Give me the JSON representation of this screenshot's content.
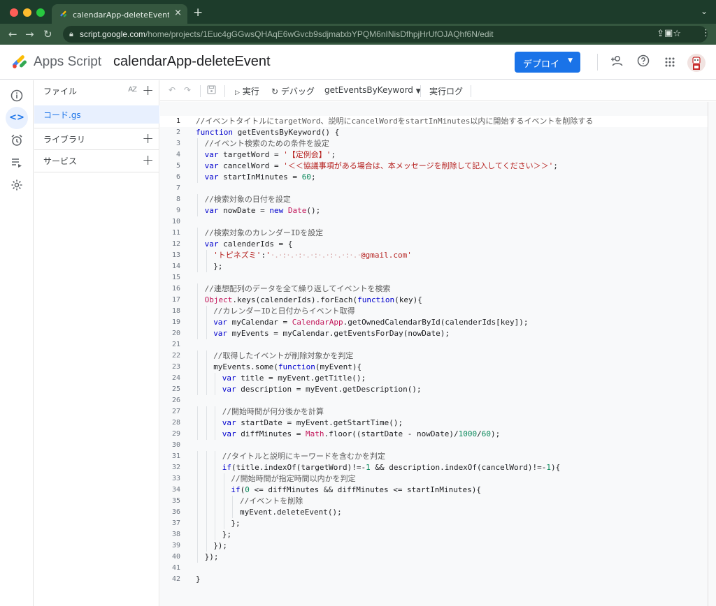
{
  "browser": {
    "tab_title": "calendarApp-deleteEvent - プロ",
    "url_host": "script.google.com",
    "url_path": "/home/projects/1Euc4gGGwsQHAqE6wGvcb9sdjmatxbYPQM6nINisDfhpjHrUfOJAQhf6N/edit"
  },
  "header": {
    "product": "Apps Script",
    "project_title": "calendarApp-deleteEvent",
    "deploy_label": "デプロイ",
    "icons": [
      "add-person-icon",
      "help-icon",
      "apps-grid-icon",
      "avatar"
    ]
  },
  "rail": {
    "items": [
      "info-icon",
      "code-icon",
      "alarm-icon",
      "executions-icon",
      "settings-icon"
    ],
    "active": "code-icon"
  },
  "files_panel": {
    "files_label": "ファイル",
    "sort_label": "AZ",
    "file": "コード.gs",
    "libraries_label": "ライブラリ",
    "services_label": "サービス"
  },
  "toolbar": {
    "run_label": "実行",
    "debug_label": "デバッグ",
    "function_name": "getEventsByKeyword",
    "log_label": "実行ログ"
  },
  "colors": {
    "accent": "#1a73e8",
    "chrome_green": "#35573f",
    "keyword": "#0000cd",
    "string": "#b5201e",
    "number": "#09885a",
    "object": "#c2185b"
  },
  "editor": {
    "current_line": 1,
    "lines": [
      {
        "n": "1",
        "indent": 0,
        "t": [
          [
            "com",
            "//イベントタイトルにtargetWord、説明にcancelWordをstartInMinutes以内に開始するイベントを削除する"
          ]
        ]
      },
      {
        "n": "2",
        "indent": 0,
        "t": [
          [
            "kw",
            "function"
          ],
          [
            "fn",
            " getEventsByKeyword() {"
          ]
        ]
      },
      {
        "n": "3",
        "indent": 1,
        "t": [
          [
            "com",
            "//イベント検索のための条件を設定"
          ]
        ]
      },
      {
        "n": "4",
        "indent": 1,
        "t": [
          [
            "kw",
            "var"
          ],
          [
            "fn",
            " targetWord = "
          ],
          [
            "str",
            "'【定例会】'"
          ],
          [
            "fn",
            ";"
          ]
        ]
      },
      {
        "n": "5",
        "indent": 1,
        "t": [
          [
            "kw",
            "var"
          ],
          [
            "fn",
            " cancelWord = "
          ],
          [
            "str",
            "'＜＜協議事項がある場合は、本メッセージを削除して記入してください＞＞'"
          ],
          [
            "fn",
            ";"
          ]
        ]
      },
      {
        "n": "6",
        "indent": 1,
        "t": [
          [
            "kw",
            "var"
          ],
          [
            "fn",
            " startInMinutes = "
          ],
          [
            "num",
            "60"
          ],
          [
            "fn",
            ";"
          ]
        ]
      },
      {
        "n": "7",
        "indent": 0,
        "t": []
      },
      {
        "n": "8",
        "indent": 1,
        "t": [
          [
            "com",
            "//検索対象の日付を設定"
          ]
        ]
      },
      {
        "n": "9",
        "indent": 1,
        "t": [
          [
            "kw",
            "var"
          ],
          [
            "fn",
            " nowDate = "
          ],
          [
            "kw",
            "new"
          ],
          [
            "fn",
            " "
          ],
          [
            "obj",
            "Date"
          ],
          [
            "fn",
            "();"
          ]
        ]
      },
      {
        "n": "10",
        "indent": 0,
        "t": []
      },
      {
        "n": "11",
        "indent": 1,
        "t": [
          [
            "com",
            "//検索対象のカレンダーIDを設定"
          ]
        ]
      },
      {
        "n": "12",
        "indent": 1,
        "t": [
          [
            "kw",
            "var"
          ],
          [
            "fn",
            " calenderIds = {"
          ]
        ]
      },
      {
        "n": "13",
        "indent": 2,
        "t": [
          [
            "str",
            "'トピネズミ'"
          ],
          [
            "fn",
            ":"
          ],
          [
            "str",
            "'"
          ],
          [
            "redact",
            "·.·:·.·:·.·:·.·:·.·:·.·"
          ],
          [
            "str",
            "@gmail.com'"
          ]
        ]
      },
      {
        "n": "14",
        "indent": 2,
        "t": [
          [
            "fn",
            "};"
          ]
        ]
      },
      {
        "n": "15",
        "indent": 0,
        "t": []
      },
      {
        "n": "16",
        "indent": 1,
        "t": [
          [
            "com",
            "//連想配列のデータを全て繰り返してイベントを検索"
          ]
        ]
      },
      {
        "n": "17",
        "indent": 1,
        "t": [
          [
            "obj",
            "Object"
          ],
          [
            "fn",
            ".keys(calenderIds).forEach("
          ],
          [
            "kw",
            "function"
          ],
          [
            "fn",
            "(key){"
          ]
        ]
      },
      {
        "n": "18",
        "indent": 2,
        "t": [
          [
            "com",
            "//カレンダーIDと日付からイベント取得"
          ]
        ]
      },
      {
        "n": "19",
        "indent": 2,
        "t": [
          [
            "kw",
            "var"
          ],
          [
            "fn",
            " myCalendar = "
          ],
          [
            "obj",
            "CalendarApp"
          ],
          [
            "fn",
            ".getOwnedCalendarById(calenderIds[key]);"
          ]
        ]
      },
      {
        "n": "20",
        "indent": 2,
        "t": [
          [
            "kw",
            "var"
          ],
          [
            "fn",
            " myEvents = myCalendar.getEventsForDay(nowDate);"
          ]
        ]
      },
      {
        "n": "21",
        "indent": 0,
        "t": []
      },
      {
        "n": "22",
        "indent": 2,
        "t": [
          [
            "com",
            "//取得したイベントが削除対象かを判定"
          ]
        ]
      },
      {
        "n": "23",
        "indent": 2,
        "t": [
          [
            "fn",
            "myEvents.some("
          ],
          [
            "kw",
            "function"
          ],
          [
            "fn",
            "(myEvent){"
          ]
        ]
      },
      {
        "n": "24",
        "indent": 3,
        "t": [
          [
            "kw",
            "var"
          ],
          [
            "fn",
            " title = myEvent.getTitle();"
          ]
        ]
      },
      {
        "n": "25",
        "indent": 3,
        "t": [
          [
            "kw",
            "var"
          ],
          [
            "fn",
            " description = myEvent.getDescription();"
          ]
        ]
      },
      {
        "n": "26",
        "indent": 0,
        "t": []
      },
      {
        "n": "27",
        "indent": 3,
        "t": [
          [
            "com",
            "//開始時間が何分後かを計算"
          ]
        ]
      },
      {
        "n": "28",
        "indent": 3,
        "t": [
          [
            "kw",
            "var"
          ],
          [
            "fn",
            " startDate = myEvent.getStartTime();"
          ]
        ]
      },
      {
        "n": "29",
        "indent": 3,
        "t": [
          [
            "kw",
            "var"
          ],
          [
            "fn",
            " diffMinutes = "
          ],
          [
            "obj",
            "Math"
          ],
          [
            "fn",
            ".floor((startDate - nowDate)/"
          ],
          [
            "num",
            "1000"
          ],
          [
            "fn",
            "/"
          ],
          [
            "num",
            "60"
          ],
          [
            "fn",
            ");"
          ]
        ]
      },
      {
        "n": "30",
        "indent": 0,
        "t": []
      },
      {
        "n": "31",
        "indent": 3,
        "t": [
          [
            "com",
            "//タイトルと説明にキーワードを含むかを判定"
          ]
        ]
      },
      {
        "n": "32",
        "indent": 3,
        "t": [
          [
            "kw",
            "if"
          ],
          [
            "fn",
            "(title.indexOf(targetWord)!=-"
          ],
          [
            "num",
            "1"
          ],
          [
            "fn",
            " && description.indexOf(cancelWord)!=-"
          ],
          [
            "num",
            "1"
          ],
          [
            "fn",
            "){"
          ]
        ]
      },
      {
        "n": "33",
        "indent": 4,
        "t": [
          [
            "com",
            "//開始時間が指定時間以内かを判定"
          ]
        ]
      },
      {
        "n": "34",
        "indent": 4,
        "t": [
          [
            "kw",
            "if"
          ],
          [
            "fn",
            "("
          ],
          [
            "num",
            "0"
          ],
          [
            "fn",
            " <= diffMinutes && diffMinutes <= startInMinutes){"
          ]
        ]
      },
      {
        "n": "35",
        "indent": 5,
        "t": [
          [
            "com",
            "//イベントを削除"
          ]
        ]
      },
      {
        "n": "36",
        "indent": 5,
        "t": [
          [
            "fn",
            "myEvent.deleteEvent();"
          ]
        ]
      },
      {
        "n": "37",
        "indent": 4,
        "t": [
          [
            "fn",
            "};"
          ]
        ]
      },
      {
        "n": "38",
        "indent": 3,
        "t": [
          [
            "fn",
            "};"
          ]
        ]
      },
      {
        "n": "39",
        "indent": 2,
        "t": [
          [
            "fn",
            "});"
          ]
        ]
      },
      {
        "n": "40",
        "indent": 1,
        "t": [
          [
            "fn",
            "});"
          ]
        ]
      },
      {
        "n": "41",
        "indent": 0,
        "t": []
      },
      {
        "n": "42",
        "indent": 0,
        "t": [
          [
            "fn",
            "}"
          ]
        ]
      }
    ]
  }
}
